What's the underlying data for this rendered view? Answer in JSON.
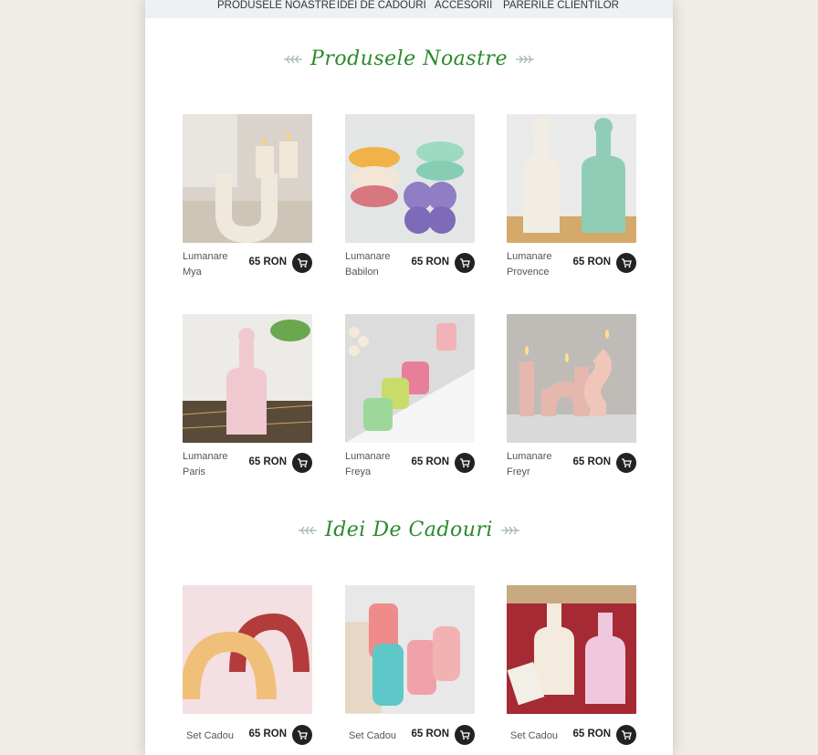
{
  "nav": [
    "PRODUSELE NOASTRE",
    "IDEI DE CADOURI",
    "ACCESORII",
    "PARERILE CLIENTILOR"
  ],
  "section_products": {
    "title": "Produsele Noastre"
  },
  "section_gifts": {
    "title": "Idei De Cadouri"
  },
  "products": [
    {
      "name": "Lumanare Mya",
      "price": "65 RON"
    },
    {
      "name": "Lumanare Babilon",
      "price": "65 RON"
    },
    {
      "name": "Lumanare Provence",
      "price": "65 RON"
    },
    {
      "name": "Lumanare Paris",
      "price": "65 RON"
    },
    {
      "name": "Lumanare Freya",
      "price": "65 RON"
    },
    {
      "name": "Lumanare Freyr",
      "price": "65 RON"
    }
  ],
  "gifts": [
    {
      "name": "Set Cadou",
      "price": "65 RON"
    },
    {
      "name": "Set Cadou",
      "price": "65 RON"
    },
    {
      "name": "Set Cadou",
      "price": "65 RON"
    }
  ],
  "icons": {
    "cart": "cart-icon",
    "leaf": "leaf-decoration-icon"
  },
  "colors": {
    "title_green": "#2b8a2b",
    "cart_bg": "#222222",
    "page_bg": "#f0ece6"
  }
}
